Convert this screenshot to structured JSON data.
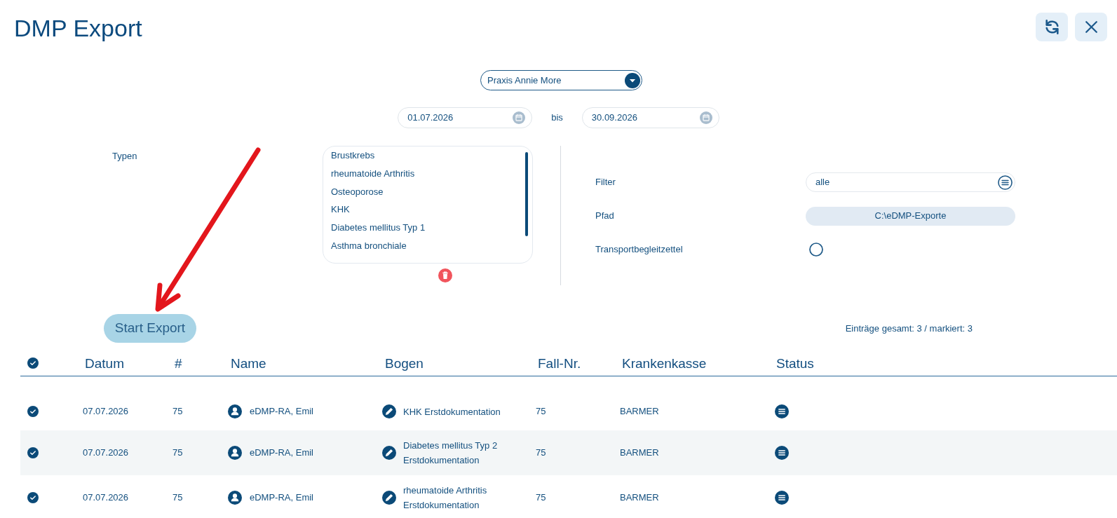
{
  "window": {
    "title": "DMP Export"
  },
  "practice_select": {
    "value": "Praxis Annie More"
  },
  "date_range": {
    "from": "01.07.2026",
    "separator": "bis",
    "to": "30.09.2026"
  },
  "types": {
    "label": "Typen",
    "items": [
      "Brustkrebs",
      "rheumatoide Arthritis",
      "Osteoporose",
      "KHK",
      "Diabetes mellitus Typ 1",
      "Asthma bronchiale"
    ]
  },
  "settings": [
    {
      "kind": "select",
      "label": "Filter",
      "value": "alle"
    },
    {
      "kind": "path",
      "label": "Pfad",
      "value": "C:\\eDMP-Exporte"
    },
    {
      "kind": "radio",
      "label": "Transportbegleitzettel",
      "checked": false
    }
  ],
  "start_button": {
    "label": "Start Export"
  },
  "summary": "Einträge gesamt: 3 / markiert: 3",
  "table": {
    "all_checked": true,
    "columns": [
      "Datum",
      "#",
      "Name",
      "Bogen",
      "Fall-Nr.",
      "Krankenkasse",
      "Status"
    ],
    "rows": [
      {
        "checked": true,
        "date": "07.07.2026",
        "number": "75",
        "name": "eDMP-RA, Emil",
        "form": "KHK Erstdokumentation",
        "case_no": "75",
        "insurer": "BARMER"
      },
      {
        "checked": true,
        "date": "07.07.2026",
        "number": "75",
        "name": "eDMP-RA, Emil",
        "form": "Diabetes mellitus Typ 2 Erstdokumentation",
        "case_no": "75",
        "insurer": "BARMER"
      },
      {
        "checked": true,
        "date": "07.07.2026",
        "number": "75",
        "name": "eDMP-RA, Emil",
        "form": "rheumatoide Arthritis Erstdokumentation",
        "case_no": "75",
        "insurer": "BARMER"
      }
    ]
  }
}
